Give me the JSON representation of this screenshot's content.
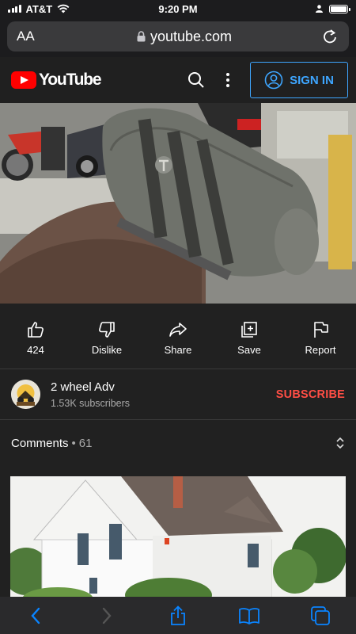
{
  "status_bar": {
    "carrier": "AT&T",
    "time": "9:20 PM"
  },
  "browser": {
    "text_size_label": "AA",
    "url": "youtube.com"
  },
  "youtube_header": {
    "logo_text": "YouTube",
    "sign_in_label": "SIGN IN"
  },
  "video": {
    "description": "Motorcycle with Triumph dry bag in garage"
  },
  "actions": [
    {
      "label": "424",
      "icon": "thumbs-up-icon"
    },
    {
      "label": "Dislike",
      "icon": "thumbs-down-icon"
    },
    {
      "label": "Share",
      "icon": "share-icon"
    },
    {
      "label": "Save",
      "icon": "save-icon"
    },
    {
      "label": "Report",
      "icon": "flag-icon"
    }
  ],
  "channel": {
    "name": "2 wheel Adv",
    "subscribers": "1.53K subscribers",
    "subscribe_label": "SUBSCRIBE"
  },
  "comments": {
    "label": "Comments",
    "separator": "•",
    "count": "61"
  },
  "colors": {
    "accent_blue": "#3ea6ff",
    "subscribe_red": "#ff4e45",
    "youtube_red": "#ff0000"
  }
}
